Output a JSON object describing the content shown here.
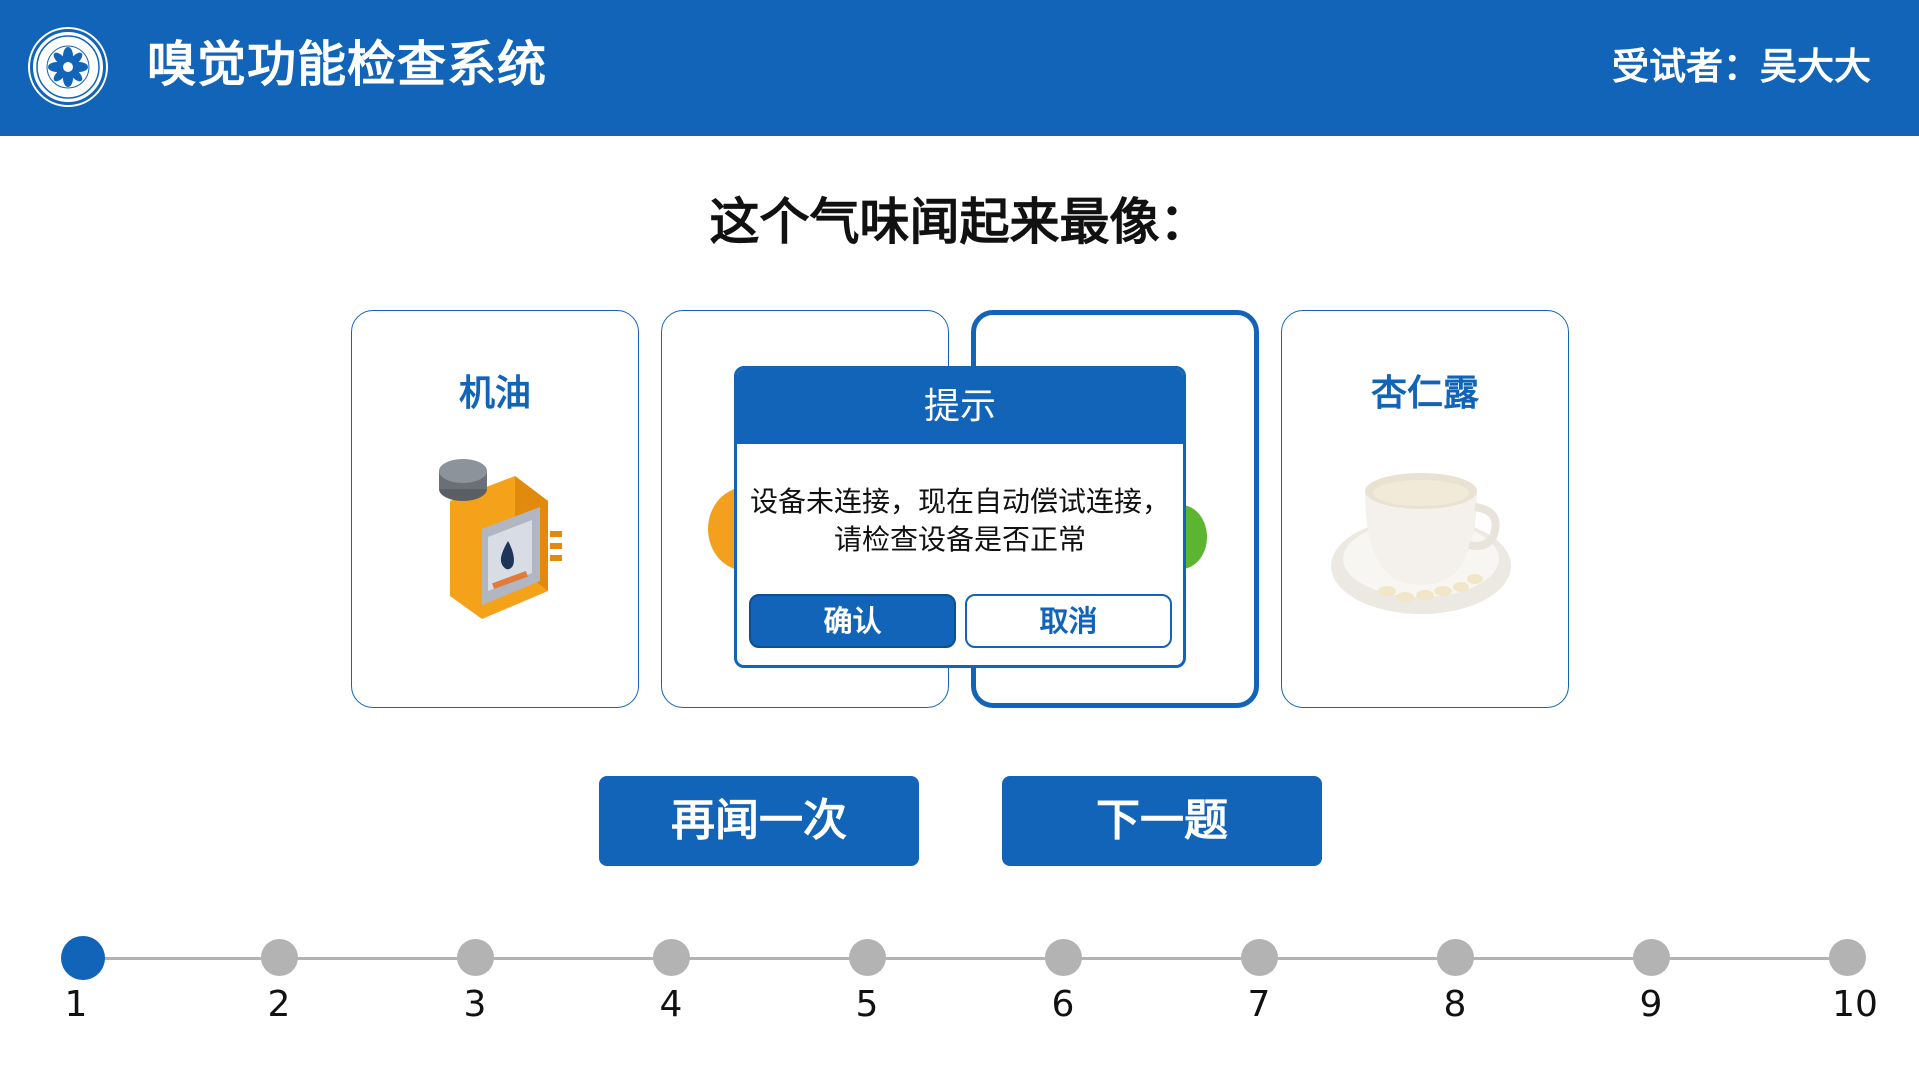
{
  "header": {
    "title": "嗅觉功能检查系统",
    "subject": "受试者：吴大大",
    "logo_icon": "academy-emblem-icon"
  },
  "question": "这个气味闻起来最像：",
  "choices": [
    {
      "label": "机油",
      "icon": "motor-oil-can-icon"
    },
    {
      "label": "",
      "icon": "orange-fruit-icon"
    },
    {
      "label": "",
      "icon": "green-leaf-icon",
      "selected": true
    },
    {
      "label": "杏仁露",
      "icon": "almond-milk-cup-icon"
    }
  ],
  "dialog": {
    "title": "提示",
    "message_line1": "设备未连接，现在自动偿试连接，",
    "message_line2": "请检查设备是否正常",
    "confirm_label": "确认",
    "cancel_label": "取消"
  },
  "actions": {
    "smell_again_label": "再闻一次",
    "next_label": "下一题"
  },
  "progress": {
    "current": 1,
    "steps": [
      "1",
      "2",
      "3",
      "4",
      "5",
      "6",
      "7",
      "8",
      "9",
      "10"
    ]
  },
  "colors": {
    "primary": "#1164b8",
    "inactive": "#b3b3b3",
    "text": "#111111"
  }
}
